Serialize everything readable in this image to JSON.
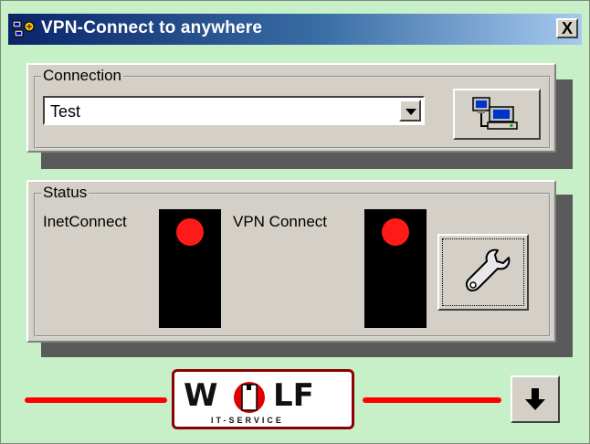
{
  "window": {
    "title": "VPN-Connect to anywhere",
    "close_label": "X"
  },
  "connection": {
    "group_label": "Connection",
    "selected_value": "Test",
    "connect_icon": "network-computers-icon"
  },
  "status": {
    "group_label": "Status",
    "inet_label": "InetConnect",
    "vpn_label": "VPN Connect",
    "inet_state_color": "#ff1a1a",
    "vpn_state_color": "#ff1a1a",
    "settings_icon": "wrench-icon"
  },
  "footer": {
    "logo_text_left": "W",
    "logo_text_right": "LF",
    "logo_subtitle": "IT-SERVICE",
    "down_icon": "arrow-down-icon"
  },
  "colors": {
    "background": "#c8f0c8",
    "panel": "#d4d0c8",
    "accent": "#ff0000"
  }
}
